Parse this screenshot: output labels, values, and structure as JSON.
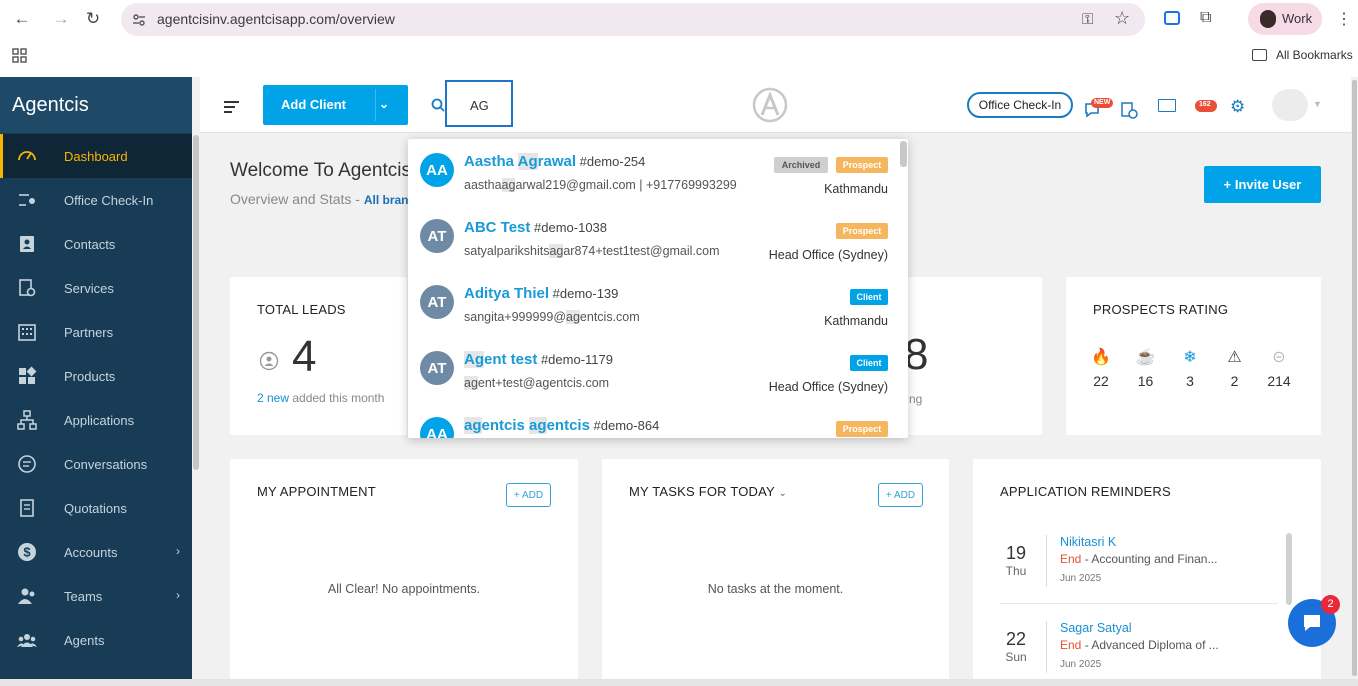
{
  "browser": {
    "url": "agentcisinv.agentcisapp.com/overview",
    "profile_label": "Work",
    "bookmarks_label": "All Bookmarks"
  },
  "sidebar": {
    "brand": "Agentcis",
    "items": [
      {
        "label": "Dashboard",
        "icon": "gauge-icon"
      },
      {
        "label": "Office Check-In",
        "icon": "checkin-icon"
      },
      {
        "label": "Contacts",
        "icon": "contacts-icon"
      },
      {
        "label": "Services",
        "icon": "services-icon"
      },
      {
        "label": "Partners",
        "icon": "building-icon"
      },
      {
        "label": "Products",
        "icon": "products-icon"
      },
      {
        "label": "Applications",
        "icon": "applications-icon"
      },
      {
        "label": "Conversations",
        "icon": "chat-icon"
      },
      {
        "label": "Quotations",
        "icon": "document-icon"
      },
      {
        "label": "Accounts",
        "icon": "dollar-icon"
      },
      {
        "label": "Teams",
        "icon": "team-icon"
      },
      {
        "label": "Agents",
        "icon": "agents-icon"
      }
    ]
  },
  "header": {
    "add_client": "Add Client",
    "search_value": "AG",
    "office_checkin": "Office Check-In",
    "new_badge": "NEW",
    "notif_count": "162"
  },
  "main": {
    "welcome": "Welcome To Agentcis",
    "subtitle": "Overview and Stats - ",
    "subtitle_link": "All bran",
    "invite_user": "+ Invite User",
    "total_leads": {
      "title": "TOTAL LEADS",
      "value": "4",
      "new_count": "2 new",
      "new_text": " added this month"
    },
    "partial_value": "8",
    "partial_text": "ng",
    "prospects_rating": {
      "title": "PROSPECTS RATING",
      "items": [
        {
          "icon": "fire-icon",
          "value": "22",
          "color": "#e94f37"
        },
        {
          "icon": "coffee-icon",
          "value": "16",
          "color": "#f5a623"
        },
        {
          "icon": "snowflake-icon",
          "value": "3",
          "color": "#1c9ad6"
        },
        {
          "icon": "warning-icon",
          "value": "2",
          "color": "#444444"
        },
        {
          "icon": "minus-circle-icon",
          "value": "214",
          "color": "#bbbbbb"
        }
      ]
    },
    "appointments": {
      "title": "MY APPOINTMENT",
      "add": "+ ADD",
      "empty": "All Clear! No appointments."
    },
    "tasks": {
      "title": "MY TASKS FOR  TODAY",
      "add": "+ ADD",
      "empty": "No tasks at the moment."
    },
    "reminders": {
      "title": "APPLICATION REMINDERS",
      "items": [
        {
          "day": "19",
          "weekday": "Thu",
          "name": "Nikitasri K",
          "end_label": "End",
          "course": " - Accounting and Finan...",
          "date": "Jun 2025"
        },
        {
          "day": "22",
          "weekday": "Sun",
          "name": "Sagar Satyal",
          "end_label": "End",
          "course": " - Advanced Diploma of ...",
          "date": "Jun 2025"
        }
      ]
    }
  },
  "search_results": [
    {
      "initials": "AA",
      "name_pre": "Aastha ",
      "name_hl": "Ag",
      "name_post": "rawal",
      "id": " #demo-254",
      "email_pre": "aastha",
      "email_hl": "ag",
      "email_post": "arwal219@gmail.com",
      "phone": "  |  +917769993299",
      "badges": [
        "Archived",
        "Prospect"
      ],
      "location": "Kathmandu"
    },
    {
      "initials": "AT",
      "name_pre": "ABC Test",
      "name_hl": "",
      "name_post": "",
      "id": " #demo-1038",
      "email_pre": "satyalparikshits",
      "email_hl": "ag",
      "email_post": "ar874+test1test@gmail.com",
      "phone": "",
      "badges": [
        "Prospect"
      ],
      "location": "Head Office (Sydney)"
    },
    {
      "initials": "AT",
      "name_pre": "Aditya Thiel",
      "name_hl": "",
      "name_post": "",
      "id": " #demo-139",
      "email_pre": "sangita+999999@",
      "email_hl": "ag",
      "email_post": "entcis.com",
      "phone": "",
      "badges": [
        "Client"
      ],
      "location": "Kathmandu"
    },
    {
      "initials": "AT",
      "name_pre": "",
      "name_hl": "Ag",
      "name_post": "ent test",
      "id": " #demo-1179",
      "email_pre": "",
      "email_hl": "ag",
      "email_post": "ent+test@agentcis.com",
      "phone": "",
      "badges": [
        "Client"
      ],
      "location": "Head Office (Sydney)"
    },
    {
      "initials": "AA",
      "name_pre": "",
      "name_hl": "ag",
      "name_post": "entcis ",
      "name_hl2": "ag",
      "name_post2": "entcis",
      "id": " #demo-864",
      "email_pre": "",
      "email_hl": "",
      "email_post": "",
      "phone": "",
      "badges": [
        "Prospect"
      ],
      "location": ""
    }
  ],
  "chat": {
    "badge": "2"
  }
}
